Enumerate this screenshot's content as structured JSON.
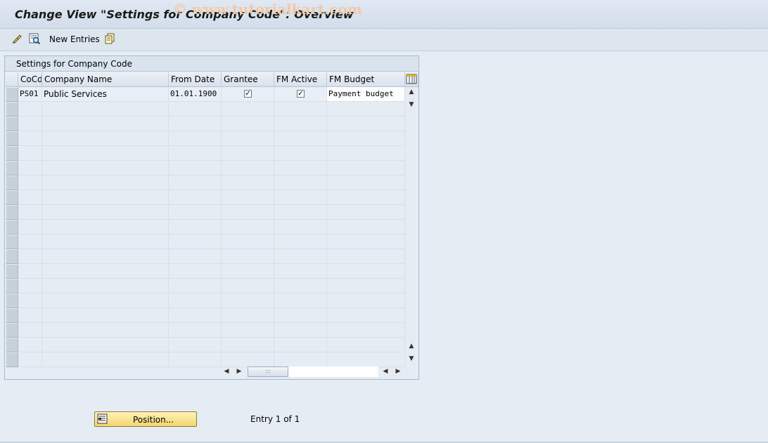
{
  "window": {
    "title": "Change View \"Settings for Company Code\": Overview"
  },
  "watermark": "© www.tutorialkart.com",
  "toolbar": {
    "new_entries_label": "New Entries",
    "icons": [
      "display-change-icon",
      "details-icon",
      "new-entries-icon",
      "copy-icon"
    ]
  },
  "panel": {
    "title": "Settings for Company Code"
  },
  "table": {
    "columns": [
      "CoCd",
      "Company Name",
      "From Date",
      "Grantee",
      "FM Active",
      "FM Budget"
    ],
    "rows": [
      {
        "cocd": "PS01",
        "company_name": "Public Services",
        "from_date": "01.01.1900",
        "grantee": "✓",
        "fm_active": "✓",
        "fm_budget": "Payment budget"
      }
    ],
    "empty_rows": 18
  },
  "footer": {
    "position_label": "Position...",
    "entry_info": "Entry 1 of 1"
  },
  "colors": {
    "background": "#e6ecf4",
    "button_yellow": "#f3d56d",
    "watermark": "#f2c9a6"
  }
}
